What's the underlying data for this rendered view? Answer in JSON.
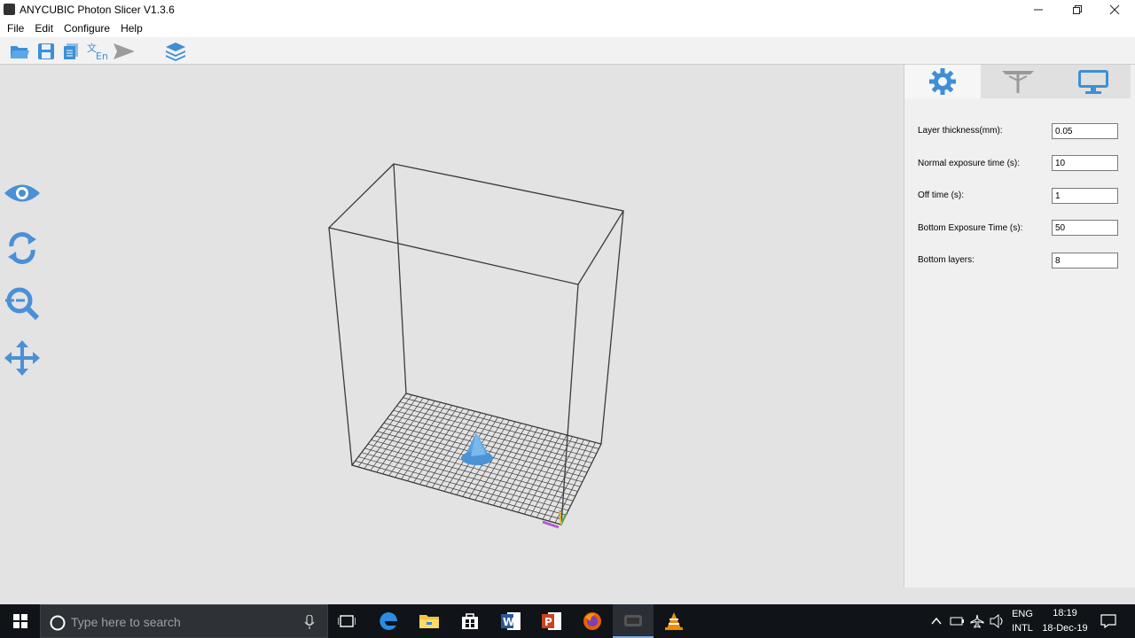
{
  "window": {
    "title": "ANYCUBIC Photon Slicer V1.3.6",
    "controls": [
      "minimize",
      "restore",
      "close"
    ]
  },
  "menu": [
    "File",
    "Edit",
    "Configure",
    "Help"
  ],
  "toolbar": {
    "buttons": [
      "open-folder-icon",
      "save-icon",
      "copy-icon",
      "language-icon",
      "slice-send-icon",
      "layers-icon"
    ]
  },
  "side_tools": [
    "eye-icon",
    "rotate-icon",
    "zoom-icon",
    "move-icon"
  ],
  "panel": {
    "tabs": [
      "gear-icon",
      "support-icon",
      "monitor-icon"
    ],
    "fields": [
      {
        "label": "Layer thickness(mm):",
        "value": "0.05"
      },
      {
        "label": "Normal exposure time (s):",
        "value": "10"
      },
      {
        "label": "Off time (s):",
        "value": "1"
      },
      {
        "label": "Bottom Exposure Time (s):",
        "value": "50"
      },
      {
        "label": "Bottom layers:",
        "value": "8"
      }
    ]
  },
  "taskbar": {
    "search_placeholder": "Type here to search",
    "lang_top": "ENG",
    "lang_bottom": "INTL",
    "time": "18:19",
    "date": "18-Dec-19"
  },
  "colors": {
    "accent": "#4a90d6",
    "taskbar": "#101418",
    "model": "#5aa2e0"
  }
}
